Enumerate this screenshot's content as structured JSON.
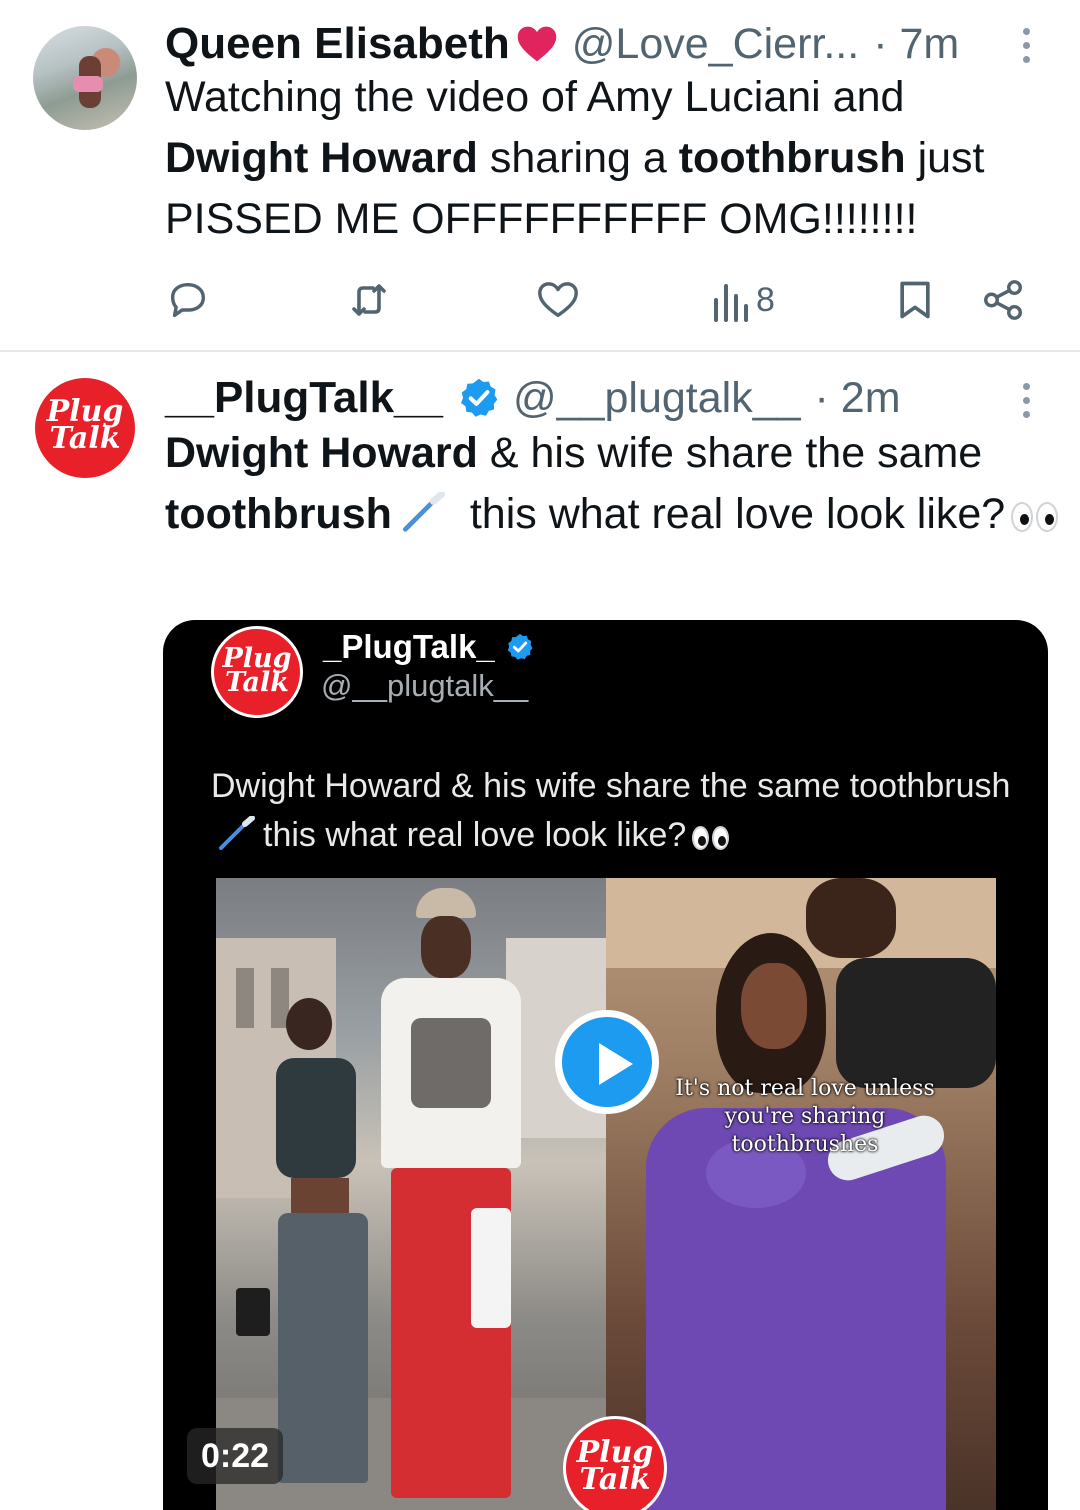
{
  "tweets": [
    {
      "display_name": "Queen Elisabeth",
      "handle": "@Love_Cierr...",
      "time": "· 7m",
      "text_parts": {
        "p1": "Watching the video of Amy Luciani and ",
        "b1": "Dwight Howard",
        "p2": " sharing a ",
        "b2": "toothbrush",
        "p3": " just PISSED ME OFFFFFFFFFF OMG!!!!!!!!"
      },
      "actions": {
        "views": "8"
      }
    },
    {
      "display_name": "__PlugTalk__",
      "handle": "@__plugtalk__",
      "time": "· 2m",
      "text_parts": {
        "b1": "Dwight Howard",
        "p1": " & his wife share the same ",
        "b2": "toothbrush",
        "p2": " this what real love look like?"
      },
      "avatar_logo": "Plug Talk",
      "media": {
        "name": "_PlugTalk_",
        "handle": "@__plugtalk__",
        "text_a": "Dwight Howard & his wife share the same toothbrush",
        "text_b": "this what real love look like?",
        "caption": "It's not real love unless you're sharing toothbrushes",
        "duration": "0:22",
        "logo": "Plug Talk"
      }
    }
  ],
  "colors": {
    "accent_blue": "#1d9bf0",
    "heart_red": "#e0245e",
    "plugtalk_red": "#e8202a",
    "muted_text": "#536471"
  },
  "icons": [
    "reply-icon",
    "repost-icon",
    "like-icon",
    "views-icon",
    "bookmark-icon",
    "share-icon",
    "more-icon",
    "verified-icon",
    "heart-emoji-icon",
    "toothbrush-emoji-icon",
    "eyes-emoji-icon",
    "play-icon"
  ]
}
